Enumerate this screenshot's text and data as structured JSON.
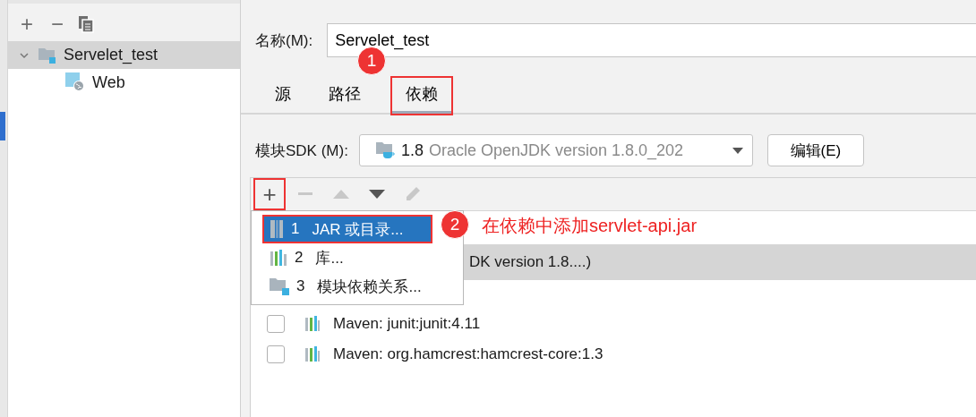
{
  "sidebar": {
    "toolbar": [
      "+",
      "−"
    ],
    "tree": [
      {
        "label": "Servelet_test",
        "selected": true,
        "expanded": true,
        "children": [
          {
            "label": "Web",
            "selected": false
          }
        ]
      }
    ]
  },
  "name_field": {
    "label": "名称(M):",
    "value": "Servelet_test"
  },
  "tabs": [
    {
      "label": "源",
      "selected": false,
      "highlighted": false
    },
    {
      "label": "路径",
      "selected": false,
      "highlighted": false
    },
    {
      "label": "依赖",
      "selected": true,
      "highlighted": true
    }
  ],
  "sdk": {
    "label": "模块SDK (M):",
    "version": "1.8",
    "detail": "Oracle OpenJDK version 1.8.0_202",
    "edit_button": "编辑(E)"
  },
  "table_toolbar": [
    {
      "kind": "add",
      "text": "+",
      "disabled": false,
      "highlighted": true
    },
    {
      "kind": "remove",
      "disabled": true,
      "highlighted": false
    },
    {
      "kind": "up",
      "disabled": true,
      "highlighted": false
    },
    {
      "kind": "down",
      "disabled": false,
      "highlighted": false
    },
    {
      "kind": "edit",
      "disabled": true,
      "highlighted": false
    }
  ],
  "rows": [
    {
      "kind": "sdk",
      "text": "DK version 1.8....)",
      "selected": true
    },
    {
      "kind": "blank"
    },
    {
      "kind": "library",
      "text": "Maven: junit:junit:4.11",
      "checked": false,
      "selected": false
    },
    {
      "kind": "library",
      "text": "Maven: org.hamcrest:hamcrest-core:1.3",
      "checked": false,
      "selected": false
    }
  ],
  "add_menu": [
    {
      "kind": "jar",
      "number": "1",
      "label": "JAR 或目录...",
      "selected": true,
      "highlighted": true
    },
    {
      "kind": "library",
      "number": "2",
      "label": "库...",
      "selected": false,
      "highlighted": false
    },
    {
      "kind": "module",
      "number": "3",
      "label": "模块依赖关系...",
      "selected": false,
      "highlighted": false
    }
  ],
  "annotations": [
    {
      "number": "1"
    },
    {
      "number": "2",
      "text": "在依赖中添加servlet-api.jar"
    }
  ]
}
